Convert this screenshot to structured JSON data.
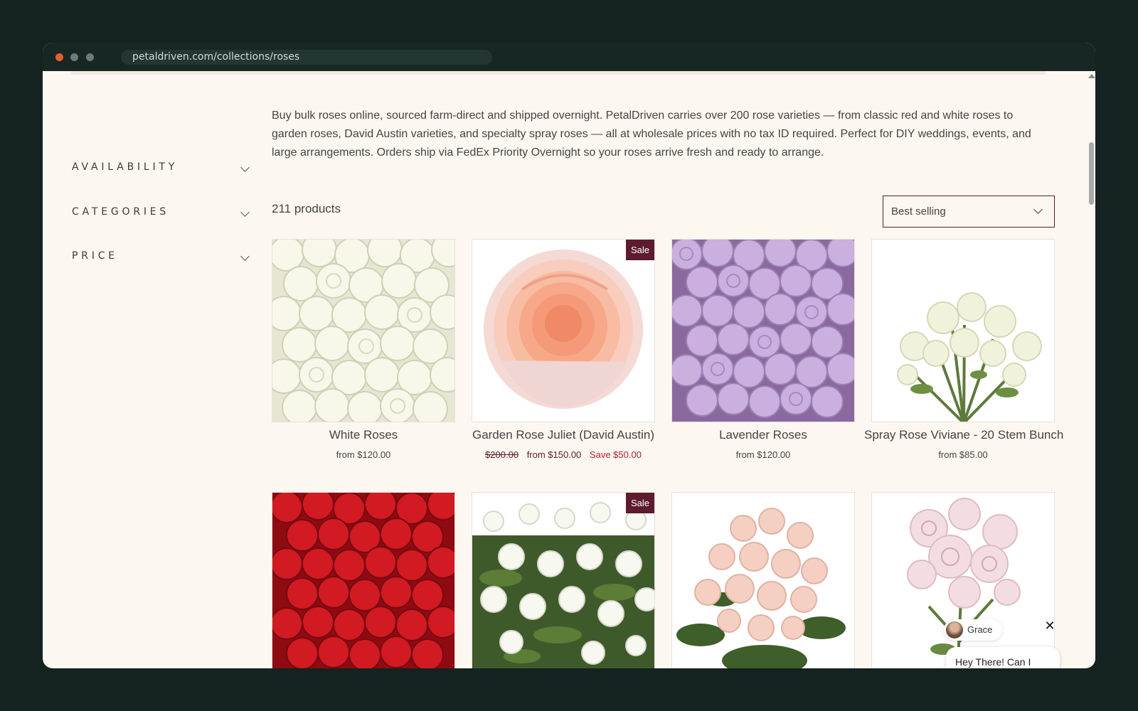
{
  "browser": {
    "url": "petaldriven.com/collections/roses"
  },
  "filters": [
    {
      "label": "AVAILABILITY",
      "icon": "chevron-down-icon"
    },
    {
      "label": "CATEGORIES",
      "icon": "chevron-down-icon"
    },
    {
      "label": "PRICE",
      "icon": "chevron-down-icon"
    }
  ],
  "collection": {
    "description": "Buy bulk roses online, sourced farm-direct and shipped overnight. PetalDriven carries over 200 rose varieties — from classic red and white roses to garden roses, David Austin varieties, and specialty spray roses — all at wholesale prices with no tax ID required. Perfect for DIY weddings, events, and large arrangements. Orders ship via FedEx Priority Overnight so your roses arrive fresh and ready to arrange.",
    "product_count": "211 products",
    "sort_selected": "Best selling"
  },
  "products": [
    {
      "title": "White Roses",
      "price": "from $120.00",
      "sale": false,
      "image": "white-roses-image"
    },
    {
      "title": "Garden Rose Juliet (David Austin)",
      "old_price": "$200.00",
      "price": "from $150.00",
      "save": "Save $50.00",
      "sale": true,
      "sale_label": "Sale",
      "image": "peach-garden-rose-image"
    },
    {
      "title": "Lavender Roses",
      "price": "from $120.00",
      "sale": false,
      "image": "lavender-roses-image"
    },
    {
      "title": "Spray Rose Viviane - 20 Stem Bunch",
      "price": "from $85.00",
      "sale": false,
      "image": "white-spray-rose-image"
    },
    {
      "image": "red-roses-image",
      "sale": false
    },
    {
      "image": "white-spray-roses-image",
      "sale": true,
      "sale_label": "Sale"
    },
    {
      "image": "pink-spray-roses-image",
      "sale": false
    },
    {
      "image": "blush-garden-rose-image",
      "sale": false
    }
  ],
  "chat": {
    "agent_name": "Grace",
    "message": "Hey There! Can I",
    "close_icon": "close-icon"
  },
  "colors": {
    "accent": "#5e1a2e",
    "sale_red": "#b0222e",
    "page_bg": "#fdf7f1"
  }
}
